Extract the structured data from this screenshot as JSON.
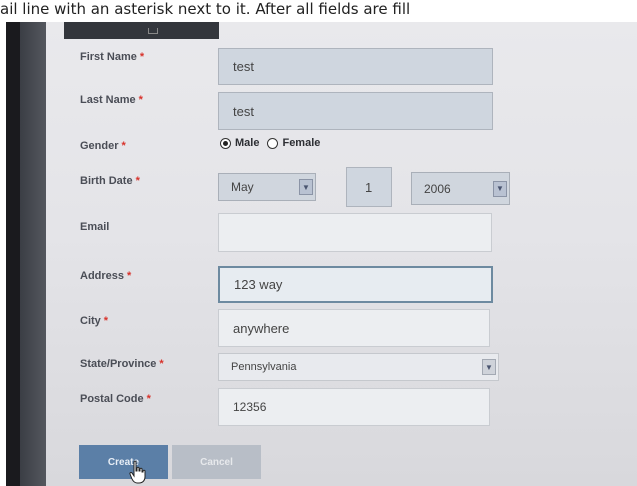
{
  "caption": "ail line with an asterisk next to it. After all fields are fill",
  "required_marker": "*",
  "form": {
    "first_name": {
      "label": "First Name",
      "value": "test"
    },
    "last_name": {
      "label": "Last Name",
      "value": "test"
    },
    "gender": {
      "label": "Gender",
      "options": [
        "Male",
        "Female"
      ],
      "selected": "Male"
    },
    "birth_date": {
      "label": "Birth Date",
      "month": "May",
      "day": "1",
      "year": "2006"
    },
    "email": {
      "label": "Email",
      "value": ""
    },
    "address": {
      "label": "Address",
      "value": "123 way"
    },
    "city": {
      "label": "City",
      "value": "anywhere"
    },
    "state": {
      "label": "State/Province",
      "value": "Pennsylvania"
    },
    "postal_code": {
      "label": "Postal Code",
      "value": "12356"
    }
  },
  "buttons": {
    "create": "Create",
    "cancel": "Cancel"
  },
  "icons": {
    "dropdown": "chevron-down-icon",
    "cursor": "hand-pointer-icon"
  },
  "colors": {
    "primary_button": "#5b7fa7",
    "required": "#d8322b",
    "field_fill": "#cfd6df"
  }
}
